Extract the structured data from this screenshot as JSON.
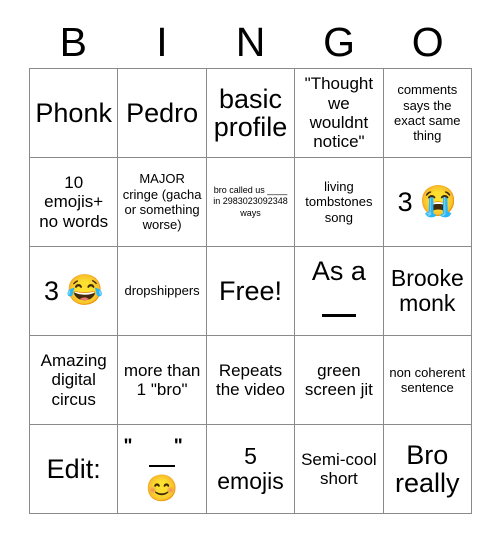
{
  "card": {
    "header_letters": [
      "B",
      "I",
      "N",
      "G",
      "O"
    ],
    "rows": [
      [
        {
          "text": "Phonk"
        },
        {
          "text": "Pedro"
        },
        {
          "text": "basic profile"
        },
        {
          "text": "\"Thought we wouldnt notice\""
        },
        {
          "text": "comments says the exact same thing"
        }
      ],
      [
        {
          "text": "10 emojis+ no words"
        },
        {
          "text": "MAJOR cringe (gacha or something worse)"
        },
        {
          "text": "bro called us ____ in 2983023092348 ways"
        },
        {
          "text": "living tombstones song"
        },
        {
          "text": "3",
          "emoji": "😭",
          "emoji_name": "loudly-crying-face-emoji"
        }
      ],
      [
        {
          "text": "3",
          "emoji": "😂",
          "emoji_name": "face-with-tears-of-joy-emoji"
        },
        {
          "text": "dropshippers"
        },
        {
          "text": "Free!"
        },
        {
          "text": "As a",
          "blank": "____"
        },
        {
          "text": "Brooke monk"
        }
      ],
      [
        {
          "text": "Amazing digital circus"
        },
        {
          "text": "more than 1 \"bro\""
        },
        {
          "text": "Repeats the video"
        },
        {
          "text": "green screen jit"
        },
        {
          "text": "non coherent sentence"
        }
      ],
      [
        {
          "text": "Edit:"
        },
        {
          "text": "\"  \"",
          "blank": "___",
          "emoji": "😊",
          "emoji_name": "smiling-face-with-smiling-eyes-emoji"
        },
        {
          "text": "5 emojis"
        },
        {
          "text": "Semi-cool short"
        },
        {
          "text": "Bro really"
        }
      ]
    ]
  },
  "colors": {
    "background": "#ffffff",
    "text": "#000000",
    "grid_line": "#8a8a8a"
  }
}
